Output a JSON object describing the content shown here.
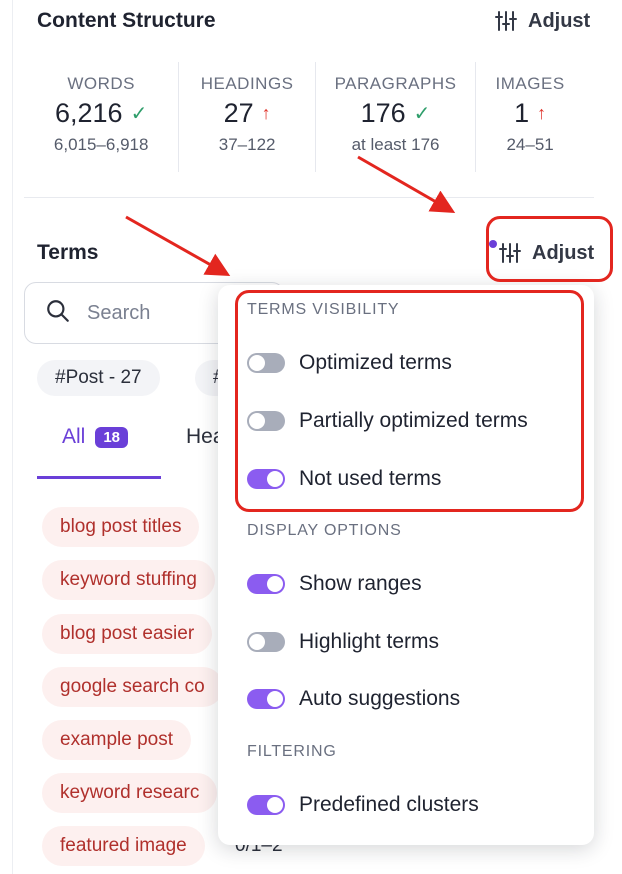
{
  "content_structure": {
    "title": "Content Structure",
    "adjust_label": "Adjust",
    "stats": [
      {
        "label": "WORDS",
        "value": "6,216",
        "range": "6,015–6,918",
        "status": "check"
      },
      {
        "label": "HEADINGS",
        "value": "27",
        "range": "37–122",
        "status": "up"
      },
      {
        "label": "PARAGRAPHS",
        "value": "176",
        "range": "at least 176",
        "status": "check"
      },
      {
        "label": "IMAGES",
        "value": "1",
        "range": "24–51",
        "status": "up"
      }
    ]
  },
  "terms": {
    "title": "Terms",
    "adjust_label": "Adjust",
    "search_placeholder": "Search",
    "chips": [
      "#Post - 27",
      "#"
    ],
    "tabs": [
      {
        "label": "All",
        "badge": "18"
      },
      {
        "label": "Hea"
      }
    ],
    "items": [
      "blog post titles",
      "keyword stuffing",
      "blog post easier",
      "google search co",
      "example post",
      "keyword researc",
      "featured image"
    ],
    "last_item_count": "0/1–2"
  },
  "dropdown": {
    "terms_visibility": {
      "heading": "TERMS VISIBILITY",
      "options": [
        {
          "label": "Optimized terms",
          "on": false
        },
        {
          "label": "Partially optimized terms",
          "on": false
        },
        {
          "label": "Not used terms",
          "on": true
        }
      ]
    },
    "display_options": {
      "heading": "DISPLAY OPTIONS",
      "options": [
        {
          "label": "Show ranges",
          "on": true
        },
        {
          "label": "Highlight terms",
          "on": false
        },
        {
          "label": "Auto suggestions",
          "on": true
        }
      ]
    },
    "filtering": {
      "heading": "FILTERING",
      "options": [
        {
          "label": "Predefined clusters",
          "on": true
        }
      ]
    }
  },
  "colors": {
    "accent": "#6a3fd8",
    "toggle_on": "#8b5cf0",
    "toggle_off": "#a8adba",
    "annotation": "#e3261f",
    "term_text": "#b0302c"
  }
}
